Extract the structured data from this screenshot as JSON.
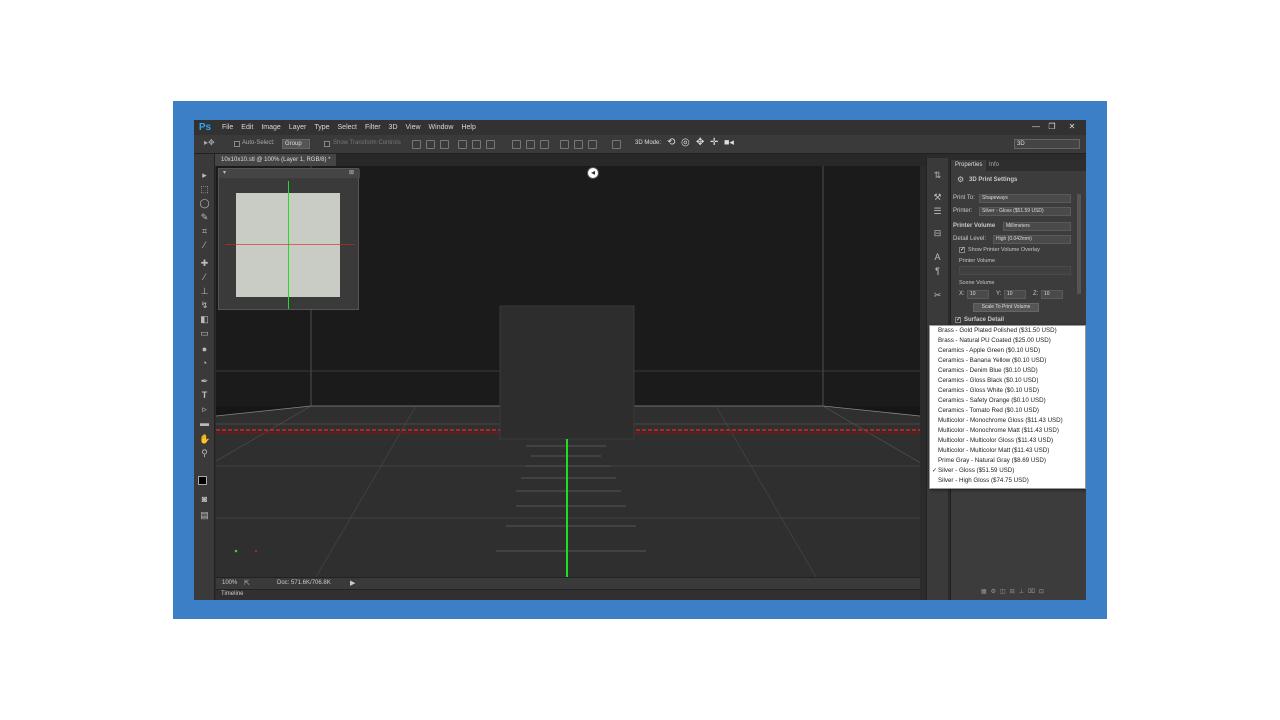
{
  "app": {
    "logo": "Ps",
    "menu": [
      "File",
      "Edit",
      "Image",
      "Layer",
      "Type",
      "Select",
      "Filter",
      "3D",
      "View",
      "Window",
      "Help"
    ],
    "window_controls": [
      "—",
      "❐",
      "✕"
    ]
  },
  "options": {
    "auto_select_label": "Auto-Select:",
    "auto_select_value": "Group",
    "show_transform_label": "Show Transform Controls",
    "mode_label": "3D Mode:",
    "workspace_value": "3D"
  },
  "document": {
    "tab_title": "10x10x10.stl @ 100% (Layer 1, RGB/8) *",
    "zoom": "100%",
    "doc_info": "Doc: 571.6K/706.8K"
  },
  "timeline": {
    "label": "Timeline"
  },
  "properties": {
    "tabs": [
      "Properties",
      "Info"
    ],
    "header": "3D Print Settings",
    "print_to_label": "Print To:",
    "print_to_value": "Shapeways",
    "printer_label": "Printer:",
    "printer_value": "Silver - Gloss ($51.59 USD)",
    "printer_volume_label": "Printer Volume",
    "printer_volume_unit": "Millimeters",
    "detail_level_label": "Detail Level:",
    "detail_level_value": "High (0.042mm)",
    "show_overlay_label": "Show Printer Volume Overlay",
    "printer_volume_sub": "Printer Volume",
    "scene_volume_label": "Scene Volume",
    "x_label": "X:",
    "x_value": "10",
    "y_label": "Y:",
    "y_value": "10",
    "z_label": "Z:",
    "z_value": "10",
    "scale_button": "Scale To Print Volume",
    "surface_detail_label": "Surface Detail"
  },
  "material_dropdown": {
    "items": [
      "Brass - Gold Plated Polished ($31.50 USD)",
      "Brass - Natural PU Coated ($25.00 USD)",
      "Ceramics - Apple Green ($0.10 USD)",
      "Ceramics - Banana Yellow ($0.10 USD)",
      "Ceramics - Denim Blue ($0.10 USD)",
      "Ceramics - Gloss Black ($0.10 USD)",
      "Ceramics - Gloss White ($0.10 USD)",
      "Ceramics - Safety Orange ($0.10 USD)",
      "Ceramics - Tomato Red ($0.10 USD)",
      "Multicolor - Monochrome Gloss ($11.43 USD)",
      "Multicolor - Monochrome Matt ($11.43 USD)",
      "Multicolor - Multicolor Gloss ($11.43 USD)",
      "Multicolor - Multicolor Matt ($11.43 USD)",
      "Prime Gray - Natural Gray ($8.69 USD)",
      "Silver - Gloss ($51.59 USD)",
      "Silver - High Gloss ($74.75 USD)"
    ],
    "selected": "Silver - Gloss ($51.59 USD)",
    "check_mark": "✓"
  },
  "colors": {
    "frame_blue": "#3d7fc6",
    "ps_blue": "#2fa3f7",
    "axis_green": "#22dd22",
    "axis_red": "#dd2222"
  }
}
